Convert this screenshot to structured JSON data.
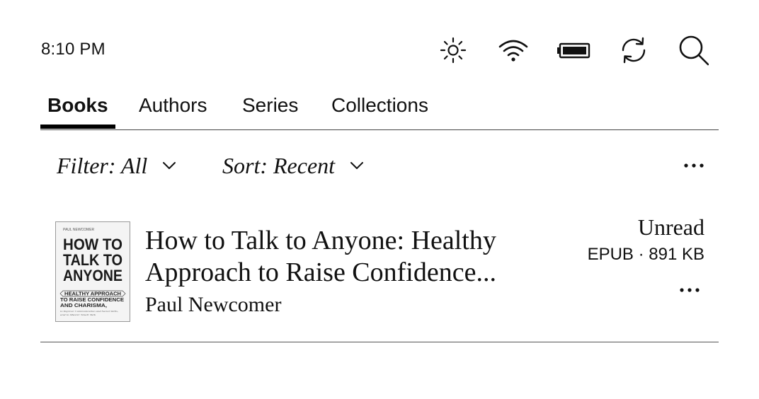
{
  "status_bar": {
    "time": "8:10 PM",
    "icons": [
      "brightness-icon",
      "wifi-icon",
      "battery-icon",
      "sync-icon",
      "search-icon"
    ]
  },
  "tabs": [
    {
      "label": "Books",
      "active": true
    },
    {
      "label": "Authors",
      "active": false
    },
    {
      "label": "Series",
      "active": false
    },
    {
      "label": "Collections",
      "active": false
    }
  ],
  "filter_bar": {
    "filter_label": "Filter: All",
    "sort_label": "Sort: Recent"
  },
  "books": [
    {
      "title": "How to Talk to Anyone: Healthy Approach to Raise Confidence...",
      "author": "Paul Newcomer",
      "status": "Unread",
      "format": "EPUB · 891 KB",
      "cover": {
        "author": "PAUL NEWCOMER",
        "title_lines": [
          "HOW TO",
          "TALK TO",
          "ANYONE"
        ],
        "subtitle_lines": [
          "HEALTHY APPROACH",
          "TO RAISE CONFIDENCE",
          "AND CHARISMA,"
        ],
        "tagline_lines": [
          "to Improve Communication and Social Skills,",
          "and to Master Small Talk"
        ]
      }
    }
  ]
}
